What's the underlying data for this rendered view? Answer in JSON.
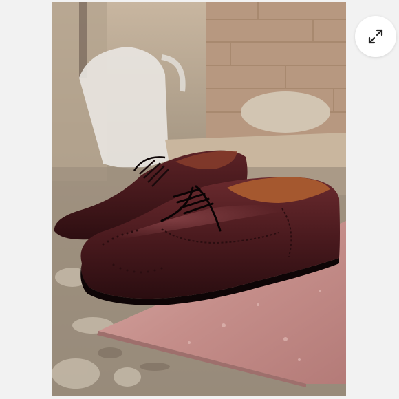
{
  "viewer": {
    "image_subject": "",
    "expand_button": {
      "icon": "expand-arrows-icon"
    }
  },
  "colors": {
    "background": "#f2f2f2",
    "leather": "#4a1a1e",
    "brick": "#b79880",
    "marble_slab": "#c48a88"
  }
}
